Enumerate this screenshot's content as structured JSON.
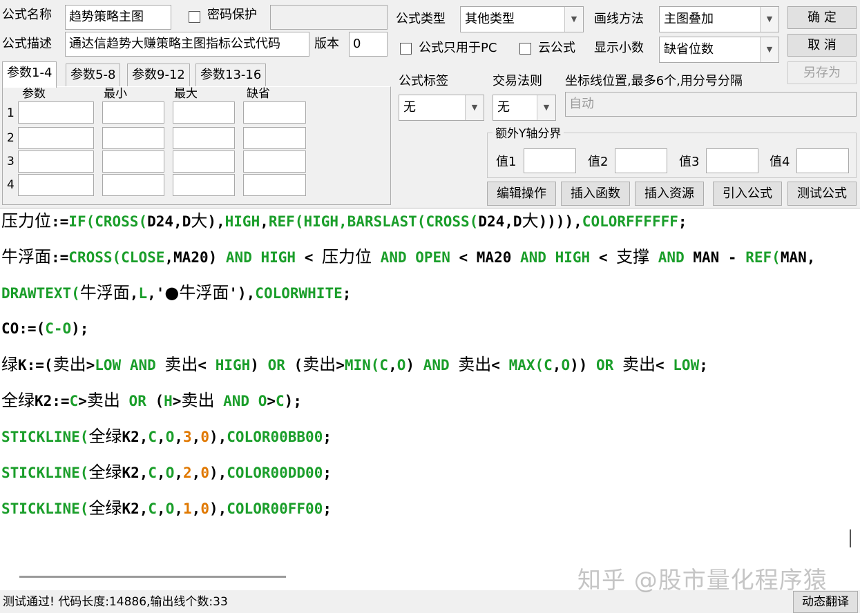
{
  "top": {
    "name_label": "公式名称",
    "name_value": "趋势策略主图",
    "password_label": "密码保护",
    "type_label": "公式类型",
    "type_value": "其他类型",
    "draw_label": "画线方法",
    "draw_value": "主图叠加",
    "ok_button": "确  定",
    "desc_label": "公式描述",
    "desc_value": "通达信趋势大赚策略主图指标公式代码",
    "version_label": "版本",
    "version_value": "0",
    "pc_only_label": "公式只用于PC",
    "cloud_label": "云公式",
    "decimals_label": "显示小数",
    "decimals_value": "缺省位数",
    "cancel_button": "取  消",
    "saveas_button": "另存为"
  },
  "params": {
    "tabs": [
      "参数1-4",
      "参数5-8",
      "参数9-12",
      "参数13-16"
    ],
    "headers": [
      "参数",
      "最小",
      "最大",
      "缺省"
    ],
    "rows": [
      "1",
      "2",
      "3",
      "4"
    ]
  },
  "right": {
    "tag_label": "公式标签",
    "tag_value": "无",
    "rule_label": "交易法则",
    "rule_value": "无",
    "coord_label": "坐标线位置,最多6个,用分号分隔",
    "coord_value": "自动",
    "extra_y_label": "额外Y轴分界",
    "values": [
      "值1",
      "值2",
      "值3",
      "值4"
    ]
  },
  "buttons": {
    "edit": "编辑操作",
    "insert_func": "插入函数",
    "insert_res": "插入资源",
    "import": "引入公式",
    "test": "测试公式",
    "translate": "动态翻译"
  },
  "code_lines": [
    [
      [
        "压力位",
        "cjk"
      ],
      [
        ":=",
        "plain"
      ],
      [
        "IF(CROSS(",
        "kw"
      ],
      [
        "D24",
        "plain"
      ],
      [
        ",",
        "plain"
      ],
      [
        "D",
        "plain"
      ],
      [
        "大",
        "cjk"
      ],
      [
        "),",
        "plain"
      ],
      [
        "HIGH",
        "kw"
      ],
      [
        ",",
        "plain"
      ],
      [
        "REF(HIGH,BARSLAST(CROSS(",
        "kw"
      ],
      [
        "D24",
        "plain"
      ],
      [
        ",",
        "plain"
      ],
      [
        "D",
        "plain"
      ],
      [
        "大",
        "cjk"
      ],
      [
        "))))",
        "plain"
      ],
      [
        ",",
        "plain"
      ],
      [
        "COLORFFFFFF",
        "kw"
      ],
      [
        ";",
        "plain"
      ]
    ],
    [
      [
        "牛浮面",
        "cjk"
      ],
      [
        ":=",
        "plain"
      ],
      [
        "CROSS(CLOSE",
        "kw"
      ],
      [
        ",",
        "plain"
      ],
      [
        "MA20",
        "plain"
      ],
      [
        ") ",
        "plain"
      ],
      [
        "AND",
        "kw"
      ],
      [
        " ",
        "plain"
      ],
      [
        "HIGH",
        "kw"
      ],
      [
        " < ",
        "plain"
      ],
      [
        "压力位",
        "cjk"
      ],
      [
        " ",
        "plain"
      ],
      [
        "AND",
        "kw"
      ],
      [
        " ",
        "plain"
      ],
      [
        "OPEN",
        "kw"
      ],
      [
        " < ",
        "plain"
      ],
      [
        "MA20",
        "plain"
      ],
      [
        " ",
        "plain"
      ],
      [
        "AND",
        "kw"
      ],
      [
        " ",
        "plain"
      ],
      [
        "HIGH",
        "kw"
      ],
      [
        " < ",
        "plain"
      ],
      [
        "支撑",
        "cjk"
      ],
      [
        " ",
        "plain"
      ],
      [
        "AND",
        "kw"
      ],
      [
        " MAN - ",
        "plain"
      ],
      [
        "REF(",
        "kw"
      ],
      [
        "MAN,",
        "plain"
      ]
    ],
    [
      [
        "DRAWTEXT(",
        "kw"
      ],
      [
        "牛浮面",
        "cjk"
      ],
      [
        ",",
        "plain"
      ],
      [
        "L",
        "kw"
      ],
      [
        ",'",
        "plain"
      ],
      [
        "●牛浮面",
        "cjk"
      ],
      [
        "'),",
        "plain"
      ],
      [
        "COLORWHITE",
        "kw"
      ],
      [
        ";",
        "plain"
      ]
    ],
    [
      [
        "CO:=(",
        "plain"
      ],
      [
        "C-O",
        "kw"
      ],
      [
        ");",
        "plain"
      ]
    ],
    [
      [
        "绿",
        "cjk"
      ],
      [
        "K:=(",
        "plain"
      ],
      [
        "卖出",
        "cjk"
      ],
      [
        ">",
        "plain"
      ],
      [
        "LOW",
        "kw"
      ],
      [
        " ",
        "plain"
      ],
      [
        "AND",
        "kw"
      ],
      [
        " ",
        "plain"
      ],
      [
        "卖出",
        "cjk"
      ],
      [
        "< ",
        "plain"
      ],
      [
        "HIGH",
        "kw"
      ],
      [
        ") ",
        "plain"
      ],
      [
        "OR",
        "kw"
      ],
      [
        " (",
        "plain"
      ],
      [
        "卖出",
        "cjk"
      ],
      [
        ">",
        "plain"
      ],
      [
        "MIN(C",
        "kw"
      ],
      [
        ",",
        "plain"
      ],
      [
        "O",
        "kw"
      ],
      [
        ") ",
        "plain"
      ],
      [
        "AND",
        "kw"
      ],
      [
        " ",
        "plain"
      ],
      [
        "卖出",
        "cjk"
      ],
      [
        "< ",
        "plain"
      ],
      [
        "MAX(C",
        "kw"
      ],
      [
        ",",
        "plain"
      ],
      [
        "O",
        "kw"
      ],
      [
        ")) ",
        "plain"
      ],
      [
        "OR",
        "kw"
      ],
      [
        " ",
        "plain"
      ],
      [
        "卖出",
        "cjk"
      ],
      [
        "< ",
        "plain"
      ],
      [
        "LOW",
        "kw"
      ],
      [
        ";",
        "plain"
      ]
    ],
    [
      [
        "全绿",
        "cjk"
      ],
      [
        "K2:=",
        "plain"
      ],
      [
        "C",
        "kw"
      ],
      [
        ">",
        "plain"
      ],
      [
        "卖出",
        "cjk"
      ],
      [
        " ",
        "plain"
      ],
      [
        "OR",
        "kw"
      ],
      [
        " (",
        "plain"
      ],
      [
        "H",
        "kw"
      ],
      [
        ">",
        "plain"
      ],
      [
        "卖出",
        "cjk"
      ],
      [
        " ",
        "plain"
      ],
      [
        "AND",
        "kw"
      ],
      [
        " ",
        "plain"
      ],
      [
        "O",
        "kw"
      ],
      [
        ">",
        "plain"
      ],
      [
        "C",
        "kw"
      ],
      [
        ");",
        "plain"
      ]
    ],
    [
      [
        "STICKLINE(",
        "kw"
      ],
      [
        "全绿",
        "cjk"
      ],
      [
        "K2,",
        "plain"
      ],
      [
        "C",
        "kw"
      ],
      [
        ",",
        "plain"
      ],
      [
        "O",
        "kw"
      ],
      [
        ",",
        "plain"
      ],
      [
        "3",
        "num"
      ],
      [
        ",",
        "plain"
      ],
      [
        "0",
        "num"
      ],
      [
        "),",
        "plain"
      ],
      [
        "COLOR00BB00",
        "kw"
      ],
      [
        ";",
        "plain"
      ]
    ],
    [
      [
        "STICKLINE(",
        "kw"
      ],
      [
        "全绿",
        "cjk"
      ],
      [
        "K2,",
        "plain"
      ],
      [
        "C",
        "kw"
      ],
      [
        ",",
        "plain"
      ],
      [
        "O",
        "kw"
      ],
      [
        ",",
        "plain"
      ],
      [
        "2",
        "num"
      ],
      [
        ",",
        "plain"
      ],
      [
        "0",
        "num"
      ],
      [
        "),",
        "plain"
      ],
      [
        "COLOR00DD00",
        "kw"
      ],
      [
        ";",
        "plain"
      ]
    ],
    [
      [
        "STICKLINE(",
        "kw"
      ],
      [
        "全绿",
        "cjk"
      ],
      [
        "K2,",
        "plain"
      ],
      [
        "C",
        "kw"
      ],
      [
        ",",
        "plain"
      ],
      [
        "O",
        "kw"
      ],
      [
        ",",
        "plain"
      ],
      [
        "1",
        "num"
      ],
      [
        ",",
        "plain"
      ],
      [
        "0",
        "num"
      ],
      [
        "),",
        "plain"
      ],
      [
        "COLOR00FF00",
        "kw"
      ],
      [
        ";",
        "plain"
      ]
    ]
  ],
  "status": "测试通过! 代码长度:14886,输出线个数:33",
  "watermark": "知乎 @股市量化程序猿",
  "colors": {
    "keyword": "#1a9e2a",
    "number": "#e07800",
    "window_bg": "#f0f0f0",
    "editor_bg": "#ffffff"
  }
}
